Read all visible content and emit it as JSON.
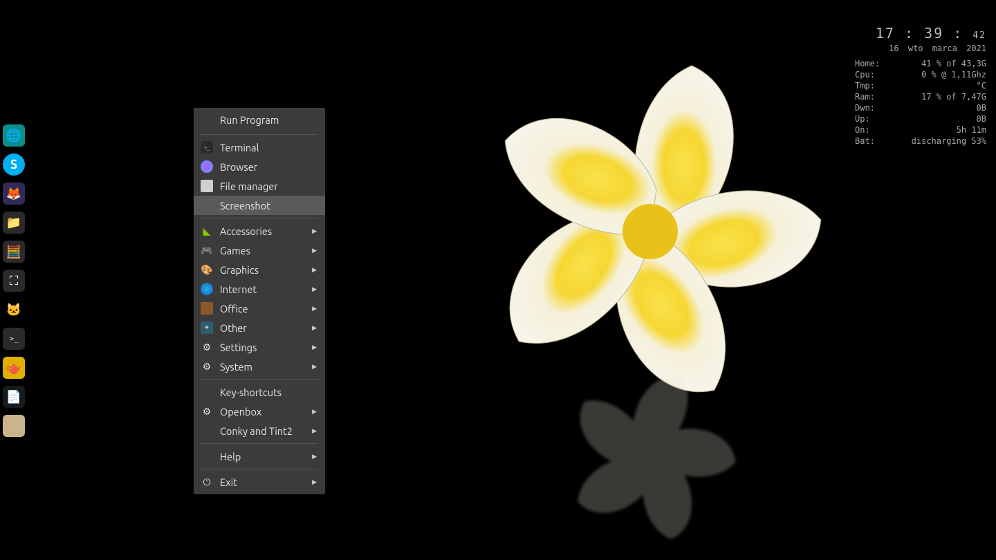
{
  "dock": [
    {
      "name": "edge-dev-icon",
      "glyph": "🌐",
      "bg": "#0b8f8a"
    },
    {
      "name": "skype-icon",
      "glyph": "S",
      "bg": "#00aff0"
    },
    {
      "name": "firefox-icon",
      "glyph": "🦊",
      "bg": "#332a58"
    },
    {
      "name": "files-icon",
      "glyph": "📁",
      "bg": "#2a2a2a"
    },
    {
      "name": "calculator-icon",
      "glyph": "🧮",
      "bg": "#2a2a2a"
    },
    {
      "name": "screenshot-icon",
      "glyph": "⛶",
      "bg": "#2a2a2a"
    },
    {
      "name": "cat-icon",
      "glyph": "🐱",
      "bg": "transparent"
    },
    {
      "name": "terminal-icon",
      "glyph": ">_",
      "bg": "#2a2a2a"
    },
    {
      "name": "teapot-icon",
      "glyph": "🫖",
      "bg": "#e0b000"
    },
    {
      "name": "notes-icon",
      "glyph": "📄",
      "bg": "#1a1a1a"
    },
    {
      "name": "blank-icon",
      "glyph": "",
      "bg": "#c9b48c"
    }
  ],
  "menu": {
    "header": "Run Program",
    "terminal": "Terminal",
    "browser": "Browser",
    "file_manager": "File manager",
    "screenshot": "Screenshot",
    "accessories": "Accessories",
    "games": "Games",
    "graphics": "Graphics",
    "internet": "Internet",
    "office": "Office",
    "other": "Other",
    "settings": "Settings",
    "system": "System",
    "key_shortcuts": "Key-shortcuts",
    "openbox": "Openbox",
    "conky_tint2": "Conky and Tint2",
    "help": "Help",
    "exit": "Exit"
  },
  "conky": {
    "time_h": "17",
    "time_m": "39",
    "time_s": "42",
    "date": "16  wto  marca  2021",
    "rows": {
      "home": {
        "k": "Home:",
        "v": "41 % of 43,3G"
      },
      "cpu": {
        "k": "Cpu:",
        "v": "0  % @ 1,11Ghz"
      },
      "tmp": {
        "k": "Tmp:",
        "v": "°C"
      },
      "ram": {
        "k": "Ram:",
        "v": "17 % of 7,47G"
      },
      "dwn": {
        "k": "Dwn:",
        "v": "0B"
      },
      "up": {
        "k": "Up:",
        "v": "0B"
      },
      "on": {
        "k": "On:",
        "v": "5h 11m"
      },
      "bat": {
        "k": "Bat:",
        "v": "discharging 53%"
      }
    }
  }
}
